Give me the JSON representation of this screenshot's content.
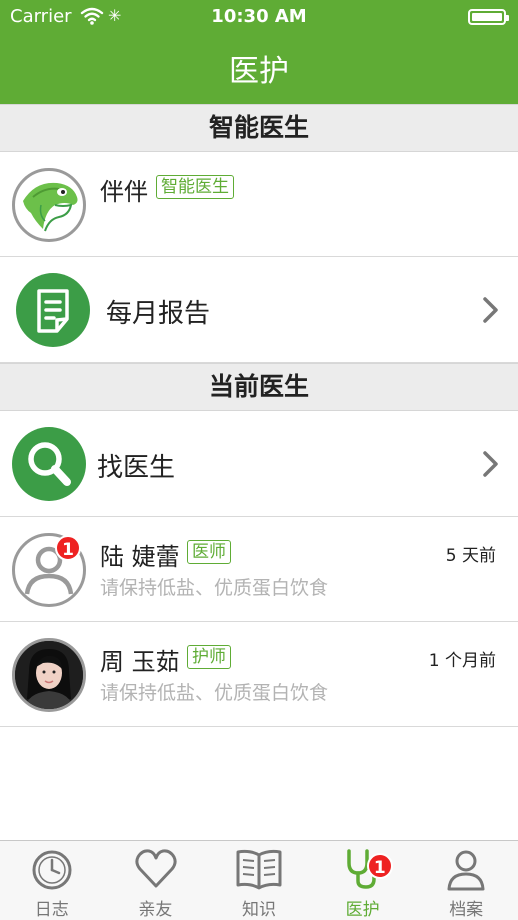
{
  "status_bar": {
    "carrier": "Carrier",
    "time": "10:30 AM"
  },
  "nav": {
    "title": "医护"
  },
  "sections": {
    "smart": "智能医生",
    "current": "当前医生"
  },
  "smart_doctor": {
    "name": "伴伴",
    "tag": "智能医生"
  },
  "monthly_report": {
    "label": "每月报告"
  },
  "find_doctor": {
    "label": "找医生"
  },
  "doctors": [
    {
      "name": "陆 婕蕾",
      "role": "医师",
      "message": "请保持低盐、优质蛋白饮食",
      "time": "5 天前",
      "badge": "1"
    },
    {
      "name": "周 玉茹",
      "role": "护师",
      "message": "请保持低盐、优质蛋白饮食",
      "time": "1 个月前"
    }
  ],
  "tabs": [
    {
      "label": "日志",
      "icon": "clock-icon"
    },
    {
      "label": "亲友",
      "icon": "heart-icon"
    },
    {
      "label": "知识",
      "icon": "book-icon"
    },
    {
      "label": "医护",
      "icon": "stethoscope-icon",
      "badge": "1",
      "active": true
    },
    {
      "label": "档案",
      "icon": "person-icon"
    }
  ],
  "colors": {
    "brand_green": "#5fac35",
    "icon_green": "#3c9d47",
    "badge_red": "#ee2222"
  }
}
